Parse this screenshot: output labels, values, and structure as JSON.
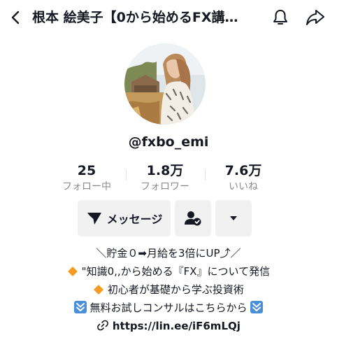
{
  "header": {
    "title": "根本 絵美子【0から始めるFX講…",
    "icons": {
      "back": "back-arrow-icon",
      "bell": "bell-icon",
      "share": "share-icon"
    }
  },
  "profile": {
    "username": "@fxbo_emi",
    "stats": [
      {
        "value": "25",
        "label": "フォロー中"
      },
      {
        "value": "1.8万",
        "label": "フォロワー"
      },
      {
        "value": "7.6万",
        "label": "いいね"
      }
    ]
  },
  "actions": {
    "message_label": "メッセージ"
  },
  "bio": {
    "line1": "＼貯金０➡月給を3倍にUP⤴︎／",
    "line2": "\"知識0,,から始める『FX』について発信",
    "line3": "初心者が基礎から学ぶ投資術",
    "line4": "無料お試しコンサルはこちらから",
    "link": "https://lin.ee/iF6mLQj"
  },
  "colors": {
    "text": "#161823",
    "secondary": "#8a8b91",
    "button_bg": "#f1f1f2",
    "diamond": "#f59a23",
    "arrow_badge": "#4a90d9"
  }
}
